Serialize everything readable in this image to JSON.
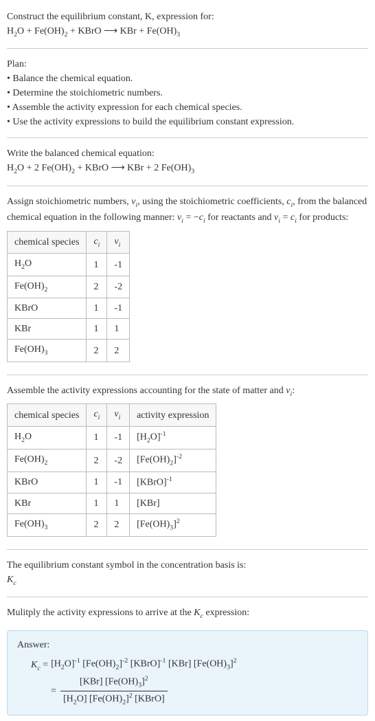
{
  "intro": {
    "line1": "Construct the equilibrium constant, K, expression for:",
    "line2_html": "H<sub>2</sub>O + Fe(OH)<sub>2</sub> + KBrO ⟶ KBr + Fe(OH)<sub>3</sub>"
  },
  "plan": {
    "heading": "Plan:",
    "items": [
      "• Balance the chemical equation.",
      "• Determine the stoichiometric numbers.",
      "• Assemble the activity expression for each chemical species.",
      "• Use the activity expressions to build the equilibrium constant expression."
    ]
  },
  "balanced": {
    "heading": "Write the balanced chemical equation:",
    "eq_html": "H<sub>2</sub>O + 2 Fe(OH)<sub>2</sub> + KBrO ⟶ KBr + 2 Fe(OH)<sub>3</sub>"
  },
  "stoich": {
    "text_html": "Assign stoichiometric numbers, <span class=\"italic\">ν<sub>i</sub></span>, using the stoichiometric coefficients, <span class=\"italic\">c<sub>i</sub></span>, from the balanced chemical equation in the following manner: <span class=\"italic\">ν<sub>i</sub></span> = −<span class=\"italic\">c<sub>i</sub></span> for reactants and <span class=\"italic\">ν<sub>i</sub></span> = <span class=\"italic\">c<sub>i</sub></span> for products:",
    "table": {
      "headers": [
        "chemical species",
        "c_i",
        "ν_i"
      ],
      "rows": [
        {
          "sp_html": "H<sub>2</sub>O",
          "c": "1",
          "v": "-1"
        },
        {
          "sp_html": "Fe(OH)<sub>2</sub>",
          "c": "2",
          "v": "-2"
        },
        {
          "sp_html": "KBrO",
          "c": "1",
          "v": "-1"
        },
        {
          "sp_html": "KBr",
          "c": "1",
          "v": "1"
        },
        {
          "sp_html": "Fe(OH)<sub>3</sub>",
          "c": "2",
          "v": "2"
        }
      ]
    }
  },
  "activity": {
    "heading_html": "Assemble the activity expressions accounting for the state of matter and <span class=\"italic\">ν<sub>i</sub></span>:",
    "table": {
      "headers": [
        "chemical species",
        "c_i",
        "ν_i",
        "activity expression"
      ],
      "rows": [
        {
          "sp_html": "H<sub>2</sub>O",
          "c": "1",
          "v": "-1",
          "act_html": "[H<sub>2</sub>O]<sup>-1</sup>"
        },
        {
          "sp_html": "Fe(OH)<sub>2</sub>",
          "c": "2",
          "v": "-2",
          "act_html": "[Fe(OH)<sub>2</sub>]<sup>-2</sup>"
        },
        {
          "sp_html": "KBrO",
          "c": "1",
          "v": "-1",
          "act_html": "[KBrO]<sup>-1</sup>"
        },
        {
          "sp_html": "KBr",
          "c": "1",
          "v": "1",
          "act_html": "[KBr]"
        },
        {
          "sp_html": "Fe(OH)<sub>3</sub>",
          "c": "2",
          "v": "2",
          "act_html": "[Fe(OH)<sub>3</sub>]<sup>2</sup>"
        }
      ]
    }
  },
  "ksymbol": {
    "line1": "The equilibrium constant symbol in the concentration basis is:",
    "line2_html": "<span class=\"italic\">K<sub>c</sub></span>"
  },
  "multiply": {
    "text_html": "Mulitply the activity expressions to arrive at the <span class=\"italic\">K<sub>c</sub></span> expression:"
  },
  "answer": {
    "label": "Answer:",
    "kc_html": "<span class=\"italic\">K<sub>c</sub></span> =",
    "expr1_html": "[H<sub>2</sub>O]<sup>-1</sup> [Fe(OH)<sub>2</sub>]<sup>-2</sup> [KBrO]<sup>-1</sup> [KBr] [Fe(OH)<sub>3</sub>]<sup>2</sup>",
    "eq_sign": "=",
    "num_html": "[KBr] [Fe(OH)<sub>3</sub>]<sup>2</sup>",
    "den_html": "[H<sub>2</sub>O] [Fe(OH)<sub>2</sub>]<sup>2</sup> [KBrO]"
  }
}
